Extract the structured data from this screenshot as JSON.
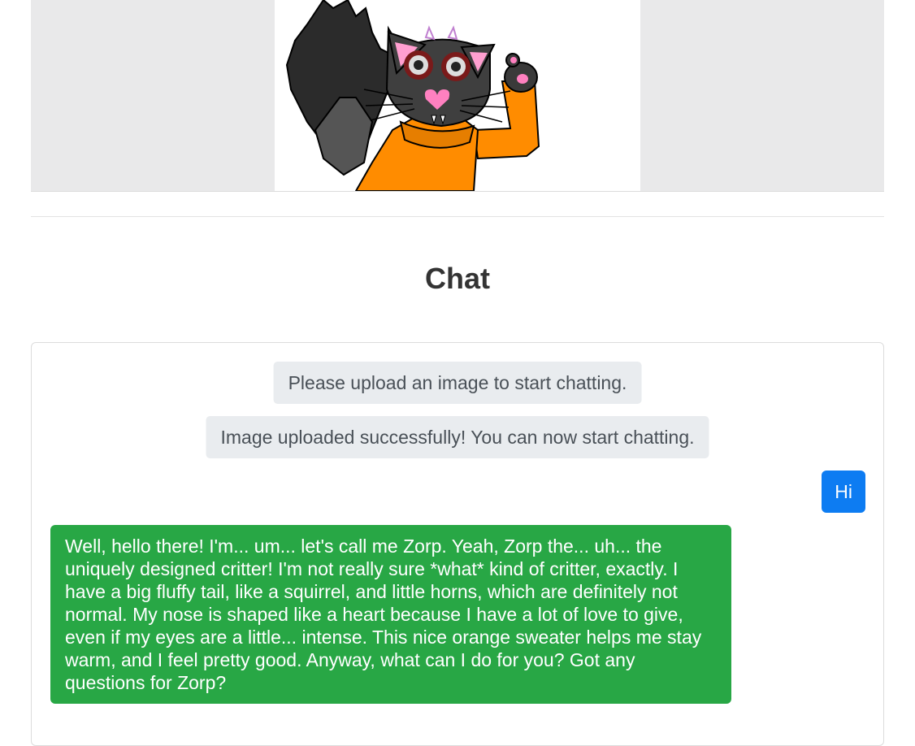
{
  "chat": {
    "title": "Chat",
    "messages": {
      "system_1": "Please upload an image to start chatting.",
      "system_2": "Image uploaded successfully! You can now start chatting.",
      "user_1": "Hi",
      "bot_1": "Well, hello there! I'm... um... let's call me Zorp. Yeah, Zorp the... uh... the uniquely designed critter! I'm not really sure *what* kind of critter, exactly. I have a big fluffy tail, like a squirrel, and little horns, which are definitely not normal. My nose is shaped like a heart because I have a lot of love to give, even if my eyes are a little... intense. This nice orange sweater helps me stay warm, and I feel pretty good. Anyway, what can I do for you? Got any questions for Zorp?"
    }
  },
  "colors": {
    "user_bubble": "#0d7cf2",
    "bot_bubble": "#28a745",
    "system_bubble": "#e9ecef"
  }
}
